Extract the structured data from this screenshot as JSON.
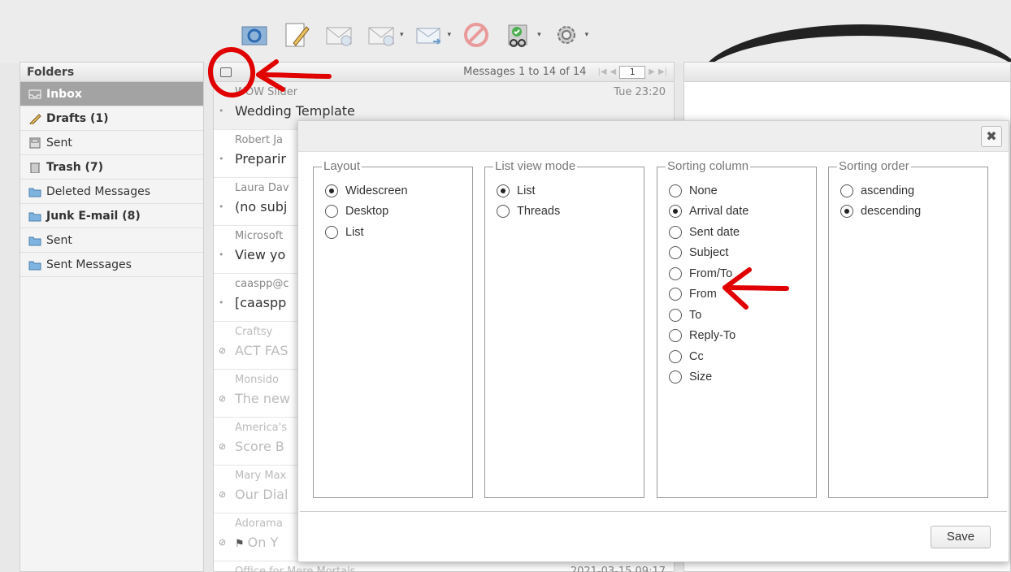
{
  "colors": {
    "annotation": "#e00000",
    "selected_folder": "#a3a3a3"
  },
  "toolbar": {
    "buttons": [
      {
        "name": "refresh-icon"
      },
      {
        "name": "compose-icon"
      },
      {
        "name": "reply-icon"
      },
      {
        "name": "reply-all-icon"
      },
      {
        "name": "forward-icon"
      },
      {
        "name": "delete-icon"
      },
      {
        "name": "mark-icon"
      },
      {
        "name": "settings-gear-icon"
      }
    ]
  },
  "folders": {
    "header": "Folders",
    "items": [
      {
        "label": "Inbox",
        "icon": "inbox-icon"
      },
      {
        "label": "Drafts (1)",
        "icon": "pencil-icon"
      },
      {
        "label": "Sent",
        "icon": "printer-icon"
      },
      {
        "label": "Trash (7)",
        "icon": "trash-icon"
      },
      {
        "label": "Deleted Messages",
        "icon": "folder-icon"
      },
      {
        "label": "Junk E-mail (8)",
        "icon": "folder-icon"
      },
      {
        "label": "Sent",
        "icon": "folder-icon"
      },
      {
        "label": "Sent Messages",
        "icon": "folder-icon"
      }
    ]
  },
  "messages": {
    "count_label": "Messages 1 to 14 of 14",
    "page": "1",
    "items": [
      {
        "from": "WOW Slider",
        "date": "Tue 23:20",
        "subject": "Wedding Template"
      },
      {
        "from": "Robert Ja",
        "subject": "Preparir"
      },
      {
        "from": "Laura Dav",
        "subject": "(no subj"
      },
      {
        "from": "Microsoft",
        "subject": "View yo"
      },
      {
        "from": "caaspp@c",
        "subject": "[caaspp"
      },
      {
        "from": "Craftsy",
        "subject": "ACT FAS"
      },
      {
        "from": "Monsido",
        "subject": "The new"
      },
      {
        "from": "America's",
        "subject": "Score B"
      },
      {
        "from": "Mary Max",
        "subject": "Our Dial"
      },
      {
        "from": "Adorama",
        "subject": "On Y"
      },
      {
        "from": "Office for Mere Mortals",
        "date": "2021-03-15 09:17"
      }
    ]
  },
  "dialog": {
    "close_symbol": "✖",
    "save_label": "Save",
    "layout": {
      "legend": "Layout",
      "options": [
        "Widescreen",
        "Desktop",
        "List"
      ],
      "selected": 0
    },
    "list_view_mode": {
      "legend": "List view mode",
      "options": [
        "List",
        "Threads"
      ],
      "selected": 0
    },
    "sorting_column": {
      "legend": "Sorting column",
      "options": [
        "None",
        "Arrival date",
        "Sent date",
        "Subject",
        "From/To",
        "From",
        "To",
        "Reply-To",
        "Cc",
        "Size"
      ],
      "selected": 1
    },
    "sorting_order": {
      "legend": "Sorting order",
      "options": [
        "ascending",
        "descending"
      ],
      "selected": 1
    }
  }
}
